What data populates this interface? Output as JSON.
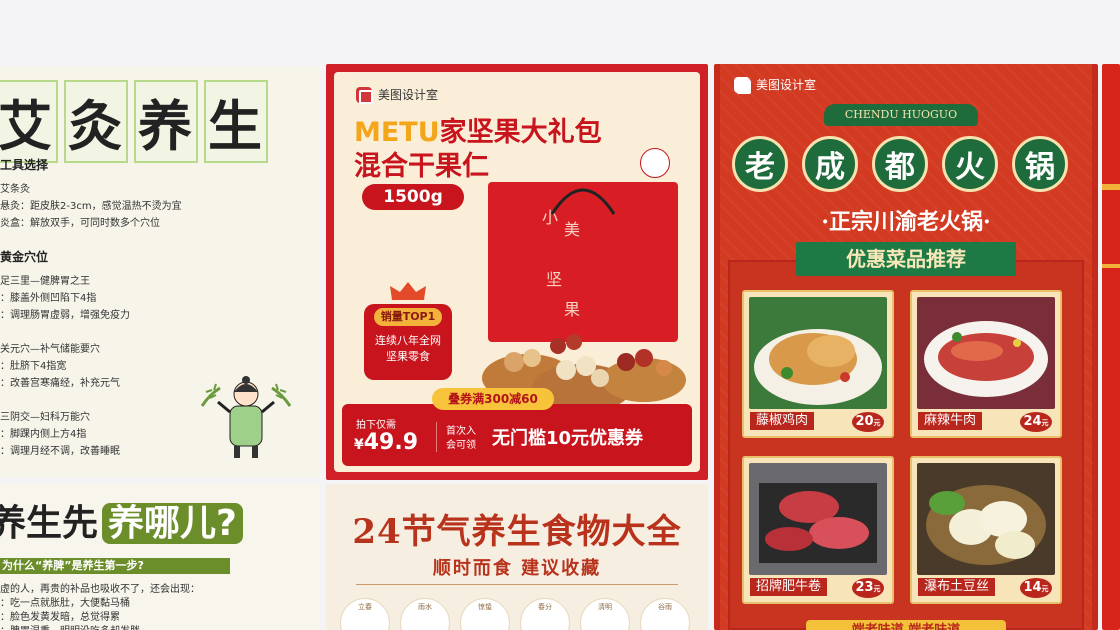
{
  "cards": {
    "moxibustion": {
      "title_chars": [
        "艾",
        "灸",
        "养",
        "生"
      ],
      "sec1": "工具选择",
      "sec1_lines": [
        "艾条灸",
        "悬灸：距皮肤2-3cm，感觉温热不烫为宜",
        "炎盒：解放双手，可同时数多个穴位"
      ],
      "sec2": "黄金穴位",
      "sec2_lines": [
        "足三里—健脾胃之王",
        "：膝盖外侧凹陷下4指",
        "：调理肠胃虚弱，增强免疫力",
        "关元穴—补气储能要穴",
        "：肚脐下4指宽",
        "：改善宫寒痛经，补充元气",
        "三阴交—妇科万能穴",
        "：脚踝内侧上方4指",
        "：调理月经不调，改善睡眠"
      ]
    },
    "nuts": {
      "logo": "美图设计室",
      "headline_brand": "METU",
      "headline_rest": "家坚果大礼包",
      "headline2": "混合干果仁",
      "weight": "1500g",
      "bag_chars": [
        "小",
        "美",
        "坚",
        "果"
      ],
      "badge_top": "销量TOP1",
      "badge_line1": "连续八年全网",
      "badge_line2": "坚果零食",
      "price_label": "拍下仅需",
      "price_symbol": "¥",
      "price": "49.9",
      "coupon_tag": "叠券满300减60",
      "coupon_hint1": "首次入",
      "coupon_hint2": "会可领",
      "coupon_text": "无门槛10元优惠券"
    },
    "hotpot": {
      "logo": "美图设计室",
      "arch_text": "CHENDU HUOGUO",
      "chips": [
        "老",
        "成",
        "都",
        "火",
        "锅"
      ],
      "subtitle": "·正宗川渝老火锅·",
      "ribbon": "优惠菜品推荐",
      "dishes": [
        {
          "name": "藤椒鸡肉",
          "price": "20",
          "unit": "元"
        },
        {
          "name": "麻辣牛肉",
          "price": "24",
          "unit": "元"
        },
        {
          "name": "招牌肥牛卷",
          "price": "23",
          "unit": "元"
        },
        {
          "name": "瀑布土豆丝",
          "price": "14",
          "unit": "元"
        }
      ],
      "footer_partial": "端老味道 端老味道"
    },
    "nourish": {
      "title_a": "养生先",
      "title_b": "养哪儿?",
      "q": "为什么“养脾”是养生第一步?",
      "lines": [
        "虚的人，再贵的补品也吸收不了，还会出现：",
        "：吃一点就胀肚，大便黏马桶",
        "：脸色发黄发暗，总觉得累",
        "：脾胃湿重，明明没吃多却发胖"
      ]
    },
    "solar": {
      "title": "24节气养生食物大全",
      "subtitle": "顺时而食 建议收藏",
      "terms": [
        "立春",
        "雨水",
        "惊蛰",
        "春分",
        "清明",
        "谷雨"
      ]
    }
  },
  "colors": {
    "red": "#c8141d",
    "gold": "#f3a61a",
    "green": "#1e6b3c",
    "page_bg": "#f4f4f6"
  }
}
